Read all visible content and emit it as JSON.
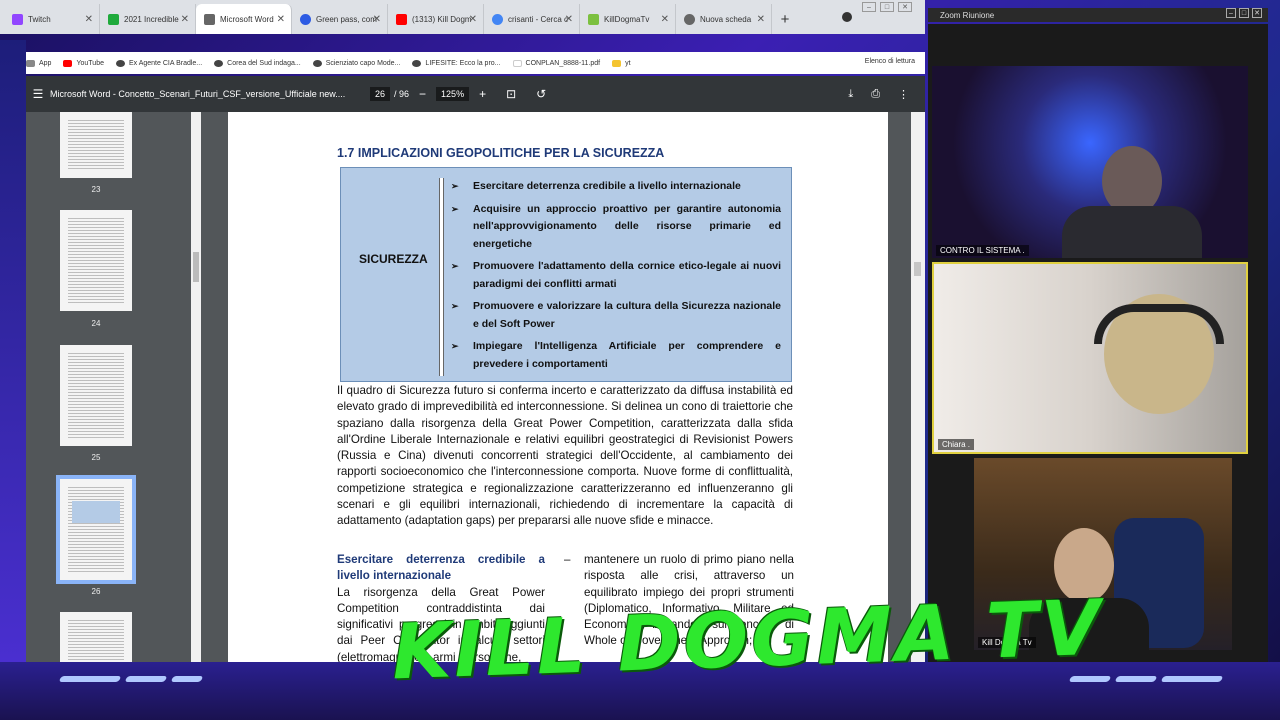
{
  "browser": {
    "tabs": [
      {
        "label": "Twitch",
        "color": "#9146ff",
        "active": false
      },
      {
        "label": "2021 Incredible",
        "color": "#1faa3c",
        "active": false
      },
      {
        "label": "Microsoft Word",
        "color": "#666666",
        "active": true
      },
      {
        "label": "Green pass, com",
        "color": "#2d5be3",
        "active": false
      },
      {
        "label": "(1313) Kill Dogm",
        "color": "#ff0000",
        "active": false
      },
      {
        "label": "crisanti - Cerca c",
        "color": "#4285f4",
        "active": false
      },
      {
        "label": "KillDogmaTv",
        "color": "#7cc040",
        "active": false
      },
      {
        "label": "Nuova scheda",
        "color": "#666666",
        "active": false
      }
    ],
    "bookmarks": [
      {
        "label": "App",
        "color": "#888888"
      },
      {
        "label": "YouTube",
        "color": "#ff0000"
      },
      {
        "label": "Ex Agente CIA Bradle...",
        "color": "#444444"
      },
      {
        "label": "Corea del Sud indaga...",
        "color": "#444444"
      },
      {
        "label": "Scienziato capo Mode...",
        "color": "#444444"
      },
      {
        "label": "LIFESITE: Ecco la pro...",
        "color": "#444444"
      },
      {
        "label": "CONPLAN_8888-11.pdf",
        "color": "#ffffff"
      },
      {
        "label": "yt",
        "color": "#f4c430"
      }
    ],
    "reading_list": "Elenco di lettura"
  },
  "pdf": {
    "title": "Microsoft Word - Concetto_Scenari_Futuri_CSF_versione_Ufficiale new....",
    "page_current": "26",
    "page_total": "/ 96",
    "zoom": "125%",
    "thumbnails": [
      "23",
      "24",
      "25",
      "26"
    ],
    "selected_thumbnail": "26"
  },
  "document": {
    "heading": "1.7 IMPLICAZIONI GEOPOLITICHE PER LA SICUREZZA",
    "box_label": "SICUREZZA",
    "bullets": [
      "Esercitare deterrenza credibile a livello internazionale",
      "Acquisire un approccio proattivo per garantire autonomia nell'approvvigionamento delle risorse primarie ed energetiche",
      "Promuovere l'adattamento della cornice etico-legale ai nuovi paradigmi dei conflitti armati",
      "Promuovere e valorizzare la cultura della Sicurezza nazionale e del Soft Power",
      "Impiegare l'Intelligenza Artificiale per comprendere e prevedere i comportamenti"
    ],
    "paragraph": "Il quadro di Sicurezza futuro si conferma incerto e caratterizzato da diffusa instabilità ed elevato grado di imprevedibilità ed interconnessione. Si delinea un cono di traiettorie che spaziano dalla risorgenza della Great Power Competition, caratterizzata dalla sfida all'Ordine Liberale Internazionale e relativi equilibri geostrategici di Revisionist Powers (Russia e Cina) divenuti concorrenti strategici dell'Occidente, al cambiamento dei rapporti socioeconomico che l'interconnessione comporta. Nuove forme di conflittualità, competizione strategica e regionalizzazione caratterizzeranno ed influenzeranno gli scenari e gli equilibri internazionali, richiedendo di incrementare la capacità di adattamento (adaptation gaps) per prepararsi alle nuove sfide e minacce.",
    "col1_sub": "Esercitare deterrenza credibile a livello internazionale",
    "col1_text": "La risorgenza della Great Power Competition contraddistinta dai significativi progressi in ambiti aggiunti dai Peer Competitor in alcuni settori (elettromagnetico, armi ipersoniche,",
    "col2_dash": "–",
    "col2_text": "mantenere un ruolo di primo piano nella risposta alle crisi, attraverso un equilibrato impiego dei propri strumenti (Diplomatico, Informativo, Militare ed Economico) basandosi sul concetto di Whole of Government Approach;"
  },
  "zoom": {
    "window_title": "Zoom Riunione",
    "participants": [
      {
        "name": "CONTRO IL SISTEMA ."
      },
      {
        "name": "Chiara ."
      },
      {
        "name": "Kill Dogma Tv"
      }
    ]
  },
  "overlay": {
    "watermark": "KILL DOGMA TV",
    "accent": "#2ee82e"
  }
}
